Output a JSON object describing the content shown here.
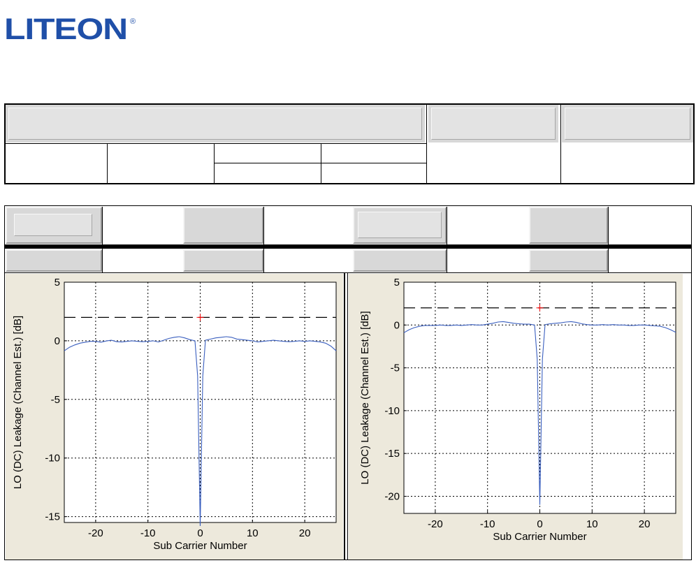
{
  "brand": {
    "logo_text": "LITEON",
    "registered_mark": "®"
  },
  "chart_data": [
    {
      "type": "line",
      "title": "",
      "xlabel": "Sub Carrier Number",
      "ylabel": "LO (DC) Leakage (Channel Est.) [dB]",
      "xlim": [
        -26,
        26
      ],
      "ylim": [
        -15.5,
        5
      ],
      "xticks": [
        -20,
        -10,
        0,
        10,
        20
      ],
      "yticks": [
        5,
        0,
        -5,
        -10,
        -15
      ],
      "grid": true,
      "limit_line": {
        "y": 2,
        "style": "dashed"
      },
      "marker": {
        "x": 0,
        "y": 2,
        "symbol": "+",
        "color": "#ff0000"
      },
      "series": [
        {
          "color": "#3a5fbf",
          "x": [
            -26,
            -25,
            -24,
            -23,
            -22,
            -21,
            -20,
            -19,
            -18,
            -17,
            -16,
            -15,
            -14,
            -13,
            -12,
            -11,
            -10,
            -9,
            -8,
            -7,
            -6,
            -5,
            -4,
            -3,
            -2,
            -1,
            -0.5,
            0,
            0.5,
            1,
            2,
            3,
            4,
            5,
            6,
            7,
            8,
            9,
            10,
            11,
            12,
            13,
            14,
            15,
            16,
            17,
            18,
            19,
            20,
            21,
            22,
            23,
            24,
            25,
            26
          ],
          "y": [
            -0.85,
            -0.55,
            -0.35,
            -0.2,
            -0.12,
            -0.05,
            -0.05,
            -0.12,
            -0.02,
            0.05,
            -0.08,
            -0.1,
            -0.05,
            0.0,
            -0.05,
            -0.08,
            -0.05,
            0.0,
            -0.1,
            0.05,
            0.2,
            0.3,
            0.35,
            0.25,
            0.1,
            0.0,
            -3.0,
            -15.8,
            -3.0,
            0.05,
            0.15,
            0.25,
            0.3,
            0.35,
            0.3,
            0.15,
            0.1,
            0.05,
            0.0,
            -0.1,
            -0.05,
            0.0,
            0.05,
            0.0,
            -0.05,
            -0.08,
            -0.05,
            0.0,
            -0.05,
            0.0,
            -0.05,
            -0.1,
            -0.2,
            -0.45,
            -0.85
          ]
        }
      ]
    },
    {
      "type": "line",
      "title": "",
      "xlabel": "Sub Carrier Number",
      "ylabel": "LO (DC) Leakage (Channel Est.) [dB]",
      "xlim": [
        -26,
        26
      ],
      "ylim": [
        -22,
        5
      ],
      "xticks": [
        -20,
        -10,
        0,
        10,
        20
      ],
      "yticks": [
        5,
        0,
        -5,
        -10,
        -15,
        -20
      ],
      "grid": true,
      "limit_line": {
        "y": 2,
        "style": "dashed"
      },
      "marker": {
        "x": 0,
        "y": 2,
        "symbol": "+",
        "color": "#ff0000"
      },
      "series": [
        {
          "color": "#3a5fbf",
          "x": [
            -26,
            -25,
            -24,
            -23,
            -22,
            -21,
            -20,
            -19,
            -18,
            -17,
            -16,
            -15,
            -14,
            -13,
            -12,
            -11,
            -10,
            -9,
            -8,
            -7,
            -6,
            -5,
            -4,
            -3,
            -2,
            -1,
            -0.5,
            0,
            0.5,
            1,
            2,
            3,
            4,
            5,
            6,
            7,
            8,
            9,
            10,
            11,
            12,
            13,
            14,
            15,
            16,
            17,
            18,
            19,
            20,
            21,
            22,
            23,
            24,
            25,
            26
          ],
          "y": [
            -0.9,
            -0.55,
            -0.3,
            -0.15,
            -0.05,
            -0.05,
            -0.05,
            0.0,
            -0.05,
            -0.05,
            0.0,
            -0.05,
            0.0,
            0.05,
            0.0,
            0.0,
            0.1,
            0.2,
            0.35,
            0.4,
            0.3,
            0.2,
            0.15,
            0.1,
            0.1,
            0.0,
            -4.0,
            -21.0,
            -4.0,
            0.05,
            0.15,
            0.2,
            0.25,
            0.35,
            0.4,
            0.3,
            0.15,
            0.05,
            0.0,
            0.0,
            0.05,
            0.0,
            0.05,
            0.0,
            0.0,
            -0.05,
            -0.05,
            0.0,
            0.0,
            -0.05,
            -0.1,
            -0.15,
            -0.3,
            -0.55,
            -0.85
          ]
        }
      ]
    }
  ]
}
